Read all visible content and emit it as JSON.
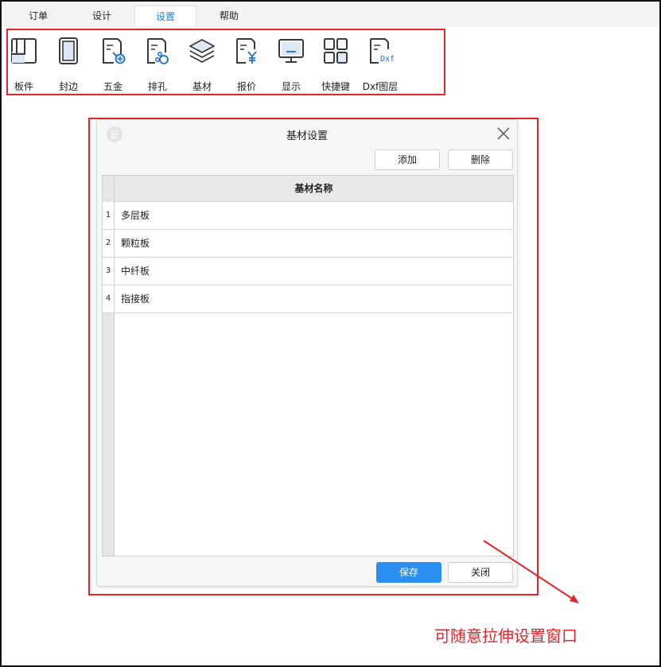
{
  "tabs": [
    {
      "label": "订单",
      "active": false
    },
    {
      "label": "设计",
      "active": false
    },
    {
      "label": "设置",
      "active": true
    },
    {
      "label": "帮助",
      "active": false
    }
  ],
  "toolbar": {
    "items": [
      {
        "label": "板件",
        "icon": "panel-icon"
      },
      {
        "label": "封边",
        "icon": "edge-banding-icon"
      },
      {
        "label": "五金",
        "icon": "hardware-icon"
      },
      {
        "label": "排孔",
        "icon": "hole-layout-icon"
      },
      {
        "label": "基材",
        "icon": "layers-icon"
      },
      {
        "label": "报价",
        "icon": "quote-yen-icon"
      },
      {
        "label": "显示",
        "icon": "monitor-icon"
      },
      {
        "label": "快捷键",
        "icon": "grid-icon"
      },
      {
        "label": "Dxf图层",
        "icon": "dxf-file-icon"
      }
    ],
    "dxf_icon_text": "Dxf"
  },
  "dialog": {
    "title": "基材设置",
    "add_label": "添加",
    "delete_label": "删除",
    "save_label": "保存",
    "close_label": "关闭",
    "table": {
      "column_header": "基材名称",
      "rows": [
        {
          "num": "1",
          "name": "多层板"
        },
        {
          "num": "2",
          "name": "颗粒板"
        },
        {
          "num": "3",
          "name": "中纤板"
        },
        {
          "num": "4",
          "name": "指接板"
        }
      ]
    }
  },
  "annotation": {
    "text": "可随意拉伸设置窗口",
    "color": "#e0262b"
  },
  "colors": {
    "accent": "#1f7fe0",
    "primary_button": "#2a8ff0",
    "highlight": "#e0262b"
  }
}
